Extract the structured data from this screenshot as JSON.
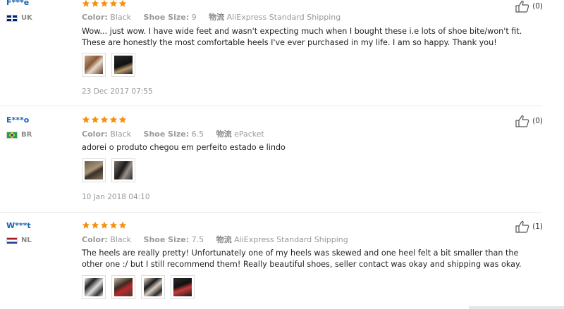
{
  "labels": {
    "color": "Color:",
    "shoe_size": "Shoe Size:",
    "logistics": "物流"
  },
  "colors": {
    "star": "#f79009",
    "username": "#1a64b4",
    "muted": "#999999"
  },
  "reviews": [
    {
      "user": "F***e",
      "country": "UK",
      "flag": "uk-flag",
      "rating": 5,
      "color": "Black",
      "shoe_size": "9",
      "shipping": "AliExpress Standard Shipping",
      "text": "Wow... just wow. I have wide feet and wasn't expecting much when I bought these i.e lots of shoe bite/won't fit. These are honestly the most comfortable heels I've ever purchased in my life. I am so happy. Thank you!",
      "photos": 2,
      "date": "23 Dec 2017 07:55",
      "helpful": "(0)"
    },
    {
      "user": "E***o",
      "country": "BR",
      "flag": "br-flag",
      "rating": 5,
      "color": "Black",
      "shoe_size": "6.5",
      "shipping": "ePacket",
      "text": "adorei o produto chegou em perfeito estado e lindo",
      "photos": 2,
      "date": "10 Jan 2018 04:10",
      "helpful": "(0)"
    },
    {
      "user": "W***t",
      "country": "NL",
      "flag": "nl-flag",
      "rating": 5,
      "color": "Black",
      "shoe_size": "7.5",
      "shipping": "AliExpress Standard Shipping",
      "text": "The heels are really pretty! Unfortunately one of my heels was skewed and one heel felt a bit smaller than the other one :/ but I still recommend them! Really beautiful shoes, seller contact was okay and shipping was okay.",
      "photos": 4,
      "date": "",
      "helpful": "(1)"
    }
  ]
}
